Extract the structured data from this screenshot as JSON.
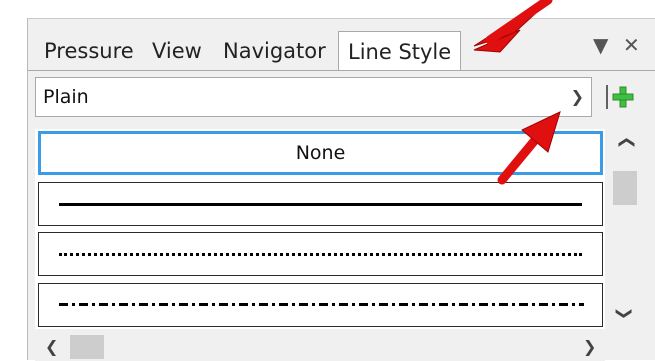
{
  "tabs": [
    {
      "label": "Pressure",
      "active": false
    },
    {
      "label": "View",
      "active": false
    },
    {
      "label": "Navigator",
      "active": false
    },
    {
      "label": "Line Style",
      "active": true
    }
  ],
  "panel_controls": {
    "menu_icon": "triangle-down-icon",
    "close_icon": "close-icon"
  },
  "style_dropdown": {
    "value": "Plain",
    "arrow_icon": "chevron-down-icon"
  },
  "add_button": {
    "icon": "plus-icon",
    "color": "#3fbf3f"
  },
  "line_styles": [
    {
      "label": "None",
      "selected": true
    },
    {
      "pattern": "solid",
      "selected": false
    },
    {
      "pattern": "dotted",
      "selected": false
    },
    {
      "pattern": "dash-dot",
      "selected": false
    }
  ],
  "colors": {
    "selection": "#3a9be6",
    "annotation": "#e01010"
  }
}
